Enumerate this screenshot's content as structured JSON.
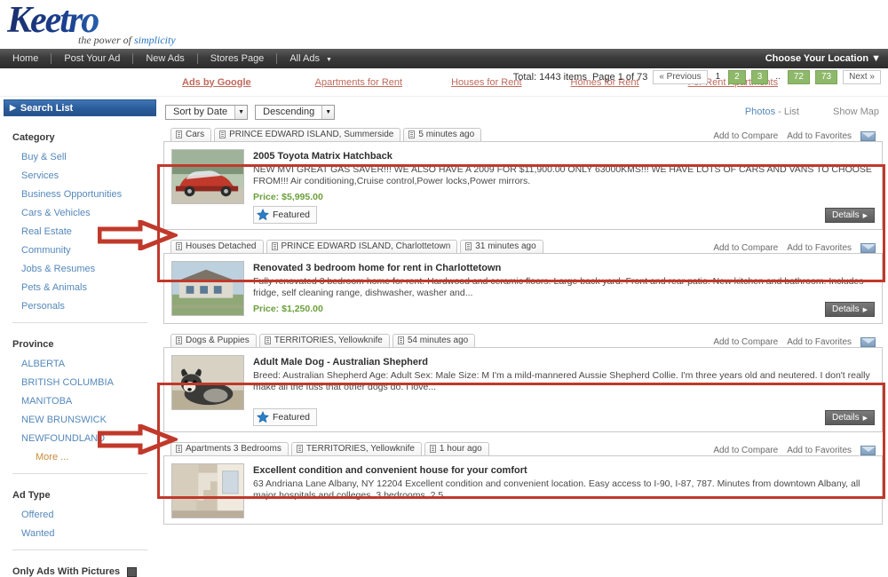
{
  "brand": {
    "name": "Keetro",
    "tagline_pre": "the power of ",
    "tagline_hl": "simplicity"
  },
  "nav": {
    "items": [
      "Home",
      "Post Your Ad",
      "New Ads",
      "Stores Page",
      "All Ads"
    ],
    "all_ads_caret": "▼",
    "location": "Choose Your Location ▼"
  },
  "google_ads": {
    "label": "Ads by Google",
    "links": [
      "Apartments for Rent",
      "Houses for Rent",
      "Homes for Rent",
      "For Rent Apartments"
    ]
  },
  "sidebar": {
    "search_list": "Search List",
    "category_title": "Category",
    "categories": [
      "Buy & Sell",
      "Services",
      "Business Opportunities",
      "Cars & Vehicles",
      "Real Estate",
      "Community",
      "Jobs & Resumes",
      "Pets & Animals",
      "Personals"
    ],
    "province_title": "Province",
    "provinces": [
      "ALBERTA",
      "BRITISH COLUMBIA",
      "MANITOBA",
      "NEW BRUNSWICK",
      "NEWFOUNDLAND"
    ],
    "more_label": "More ...",
    "adtype_title": "Ad Type",
    "adtypes": [
      "Offered",
      "Wanted"
    ],
    "only_pics_label": "Only Ads With Pictures"
  },
  "pagination": {
    "total": "Total: 1443 items",
    "page_of": "Page 1 of 73",
    "previous": "« Previous",
    "current": "1",
    "pages": [
      "2",
      "3"
    ],
    "dots": "..",
    "last_pages": [
      "72",
      "73"
    ],
    "next": "Next »"
  },
  "toolbar": {
    "sort_by": "Sort by Date",
    "order": "Descending",
    "caret": "▼",
    "photos": "Photos",
    "dash": " - ",
    "list": "List",
    "show_map": "Show Map"
  },
  "actions": {
    "compare": "Add to Compare",
    "favorites": "Add to Favorites"
  },
  "details_label": "Details",
  "details_caret": "▶",
  "featured_label": "Featured",
  "listings": [
    {
      "category": "Cars",
      "location": "PRINCE EDWARD ISLAND, Summerside",
      "time": "5 minutes ago",
      "title": "2005 Toyota Matrix Hatchback",
      "desc": "NEW MVI GREAT GAS SAVER!!! WE ALSO HAVE A 2009 FOR $11,900.00 ONLY 63000KMS!!! WE HAVE LOTS OF CARS AND VANS TO CHOOSE FROM!!! Air conditioning,Cruise control,Power locks,Power mirrors.",
      "price": "Price: $5,995.00",
      "featured": true,
      "thumb": "car"
    },
    {
      "category": "Houses Detached",
      "location": "PRINCE EDWARD ISLAND, Charlottetown",
      "time": "31 minutes ago",
      "title": "Renovated 3 bedroom home for rent in Charlottetown",
      "desc": "Fully renovated 3 bedroom home for rent. Hardwood and ceramic floors. Large back yard. Front and rear patio. New kitchen and bathroom. Includes fridge, self cleaning range, dishwasher, washer and...",
      "price": "Price: $1,250.00",
      "featured": false,
      "thumb": "house"
    },
    {
      "category": "Dogs & Puppies",
      "location": "TERRITORIES, Yellowknife",
      "time": "54 minutes ago",
      "title": "Adult Male Dog - Australian Shepherd",
      "desc": "Breed: Australian Shepherd Age: Adult Sex: Male Size: M I'm a mild-mannered Aussie Shepherd Collie. I'm three years old and neutered. I don't really make all the fuss that other dogs do. I love...",
      "price": "",
      "featured": true,
      "thumb": "dog"
    },
    {
      "category": "Apartments 3 Bedrooms",
      "location": "TERRITORIES, Yellowknife",
      "time": "1 hour ago",
      "title": "Excellent condition and convenient house for your comfort",
      "desc": "63 Andriana Lane Albany, NY 12204 Excellent condition and convenient location. Easy access to I-90, I-87, 787. Minutes from downtown Albany, all major hospitals and colleges. 3 bedrooms, 2.5",
      "price": "",
      "featured": false,
      "thumb": "stairs"
    }
  ],
  "colors": {
    "accent_red": "#c0392b",
    "price_green": "#6aa03c",
    "link_blue": "#5588bb"
  }
}
